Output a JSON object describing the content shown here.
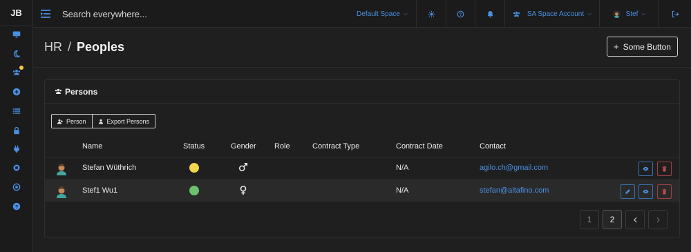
{
  "app": {
    "logo": "JB"
  },
  "sidebar": {
    "items": [
      {
        "icon": "monitor-icon"
      },
      {
        "icon": "moon-icon"
      },
      {
        "icon": "users-icon",
        "has_badge": true
      },
      {
        "icon": "plus-circle-icon"
      },
      {
        "icon": "list-icon"
      },
      {
        "icon": "lock-icon"
      },
      {
        "icon": "plug-icon"
      },
      {
        "icon": "chip-icon"
      },
      {
        "icon": "target-icon"
      },
      {
        "icon": "help-icon"
      }
    ]
  },
  "topbar": {
    "search_placeholder": "Search everywhere...",
    "space_label": "Default Space",
    "account_label": "SA Space Account",
    "user_label": "Stef"
  },
  "header": {
    "breadcrumb_root": "HR",
    "breadcrumb_separator": "/",
    "breadcrumb_current": "Peoples",
    "action_label": "Some Button"
  },
  "card": {
    "title": "Persons",
    "buttons": {
      "add_person": "Person",
      "export": "Export Persons"
    }
  },
  "table": {
    "columns": [
      "Name",
      "Status",
      "Gender",
      "Role",
      "Contract Type",
      "Contract Date",
      "Contact"
    ],
    "rows": [
      {
        "name": "Stefan Wüthrich",
        "status_color": "#f2d64b",
        "gender": "male",
        "role": "",
        "contract_type": "",
        "contract_date": "N/A",
        "contact": "agilo.ch@gmail.com"
      },
      {
        "name": "Stef1 Wu1",
        "status_color": "#6cc070",
        "gender": "female",
        "role": "",
        "contract_type": "",
        "contract_date": "N/A",
        "contact": "stefan@altafino.com"
      }
    ]
  },
  "pagination": {
    "pages": [
      "1",
      "2"
    ],
    "current_page": "2"
  },
  "colors": {
    "accent": "#4a90e2",
    "danger": "#c94c4c",
    "background": "#1f1f1f"
  }
}
